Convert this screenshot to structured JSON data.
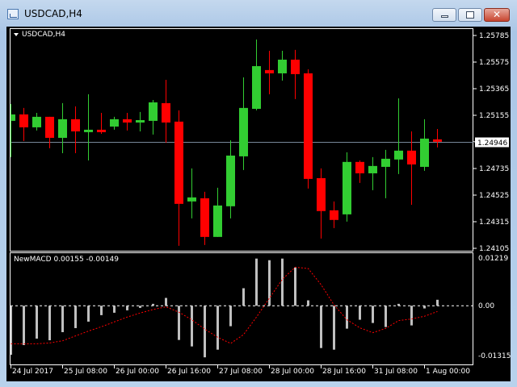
{
  "window": {
    "title": "USDCAD,H4",
    "close_glyph": "✕"
  },
  "main": {
    "symbol_label": "USDCAD,H4",
    "price_ticks": [
      "1.25785",
      "1.25575",
      "1.25365",
      "1.25155",
      "1.24946",
      "1.24735",
      "1.24525",
      "1.24315",
      "1.24105"
    ],
    "current_price": "1.24946",
    "colors": {
      "bull": "#32cd32",
      "bear": "#ff0000",
      "price_line": "#778899"
    }
  },
  "macd": {
    "label": "NewMACD 0.00155 -0.00149",
    "ticks": [
      "0.01219",
      "0.00",
      "-0.01315"
    ]
  },
  "time_labels": [
    "24 Jul 2017",
    "25 Jul 08:00",
    "26 Jul 00:00",
    "26 Jul 16:00",
    "27 Jul 08:00",
    "28 Jul 00:00",
    "28 Jul 16:00",
    "31 Jul 08:00",
    "1 Aug 00:00"
  ],
  "chart_data": [
    {
      "type": "candlestick",
      "title": "USDCAD,H4",
      "ylim": [
        1.24105,
        1.25785
      ],
      "ohlc": [
        [
          1.25111,
          1.25244,
          1.24825,
          1.25162
        ],
        [
          1.25162,
          1.25213,
          1.24952,
          1.2506
        ],
        [
          1.2506,
          1.25174,
          1.25035,
          1.25143
        ],
        [
          1.25143,
          1.25143,
          1.24895,
          1.24977
        ],
        [
          1.24977,
          1.25251,
          1.24856,
          1.25124
        ],
        [
          1.25124,
          1.25225,
          1.24856,
          1.25028
        ],
        [
          1.25022,
          1.25321,
          1.24799,
          1.25041
        ],
        [
          1.25041,
          1.25174,
          1.25009,
          1.25022
        ],
        [
          1.25066,
          1.25143,
          1.25041,
          1.25124
        ],
        [
          1.25124,
          1.25174,
          1.25035,
          1.25098
        ],
        [
          1.25098,
          1.25181,
          1.25028,
          1.25117
        ],
        [
          1.25111,
          1.25276,
          1.25003,
          1.25257
        ],
        [
          1.25251,
          1.25435,
          1.24939,
          1.25098
        ],
        [
          1.25105,
          1.25194,
          1.24125,
          1.24456
        ],
        [
          1.24475,
          1.24736,
          1.24341,
          1.24507
        ],
        [
          1.245,
          1.24551,
          1.24131,
          1.24195
        ],
        [
          1.24195,
          1.24583,
          1.24195,
          1.24443
        ],
        [
          1.24437,
          1.24958,
          1.24341,
          1.24837
        ],
        [
          1.24831,
          1.25454,
          1.24723,
          1.25213
        ],
        [
          1.25206,
          1.25753,
          1.25194,
          1.25543
        ],
        [
          1.25512,
          1.25664,
          1.25321,
          1.25486
        ],
        [
          1.25486,
          1.25664,
          1.25429,
          1.25594
        ],
        [
          1.25594,
          1.25671,
          1.25283,
          1.2548
        ],
        [
          1.25486,
          1.25518,
          1.24577,
          1.24653
        ],
        [
          1.24659,
          1.24736,
          1.24182,
          1.24399
        ],
        [
          1.24405,
          1.24475,
          1.24265,
          1.24329
        ],
        [
          1.24373,
          1.24863,
          1.24316,
          1.24787
        ],
        [
          1.24787,
          1.24799,
          1.24621,
          1.24697
        ],
        [
          1.24697,
          1.24825,
          1.24564,
          1.24755
        ],
        [
          1.24748,
          1.24882,
          1.245,
          1.24812
        ],
        [
          1.24806,
          1.25289,
          1.24691,
          1.24876
        ],
        [
          1.24876,
          1.25028,
          1.24449,
          1.24767
        ],
        [
          1.24748,
          1.25124,
          1.24717,
          1.24971
        ],
        [
          1.24965,
          1.25047,
          1.24901,
          1.24946
        ]
      ]
    },
    {
      "type": "bar+line",
      "title": "NewMACD",
      "ylim": [
        -0.01315,
        0.01219
      ],
      "histogram": [
        -0.01274,
        -0.01022,
        -0.00854,
        -0.00896,
        -0.00686,
        -0.00581,
        -0.00413,
        -0.00245,
        -0.00182,
        -0.00119,
        -0.00056,
        0.00049,
        0.00203,
        -0.00889,
        -0.01057,
        -0.0134,
        -0.01141,
        -0.00532,
        0.00455,
        0.01225,
        0.01183,
        0.01225,
        0.00994,
        0.0014,
        -0.01099,
        -0.01141,
        -0.00595,
        -0.00364,
        -0.00448,
        -0.00553,
        0.00049,
        -0.00511,
        -0.0007,
        0.00155
      ],
      "signal": [
        -0.00987,
        -0.0099,
        -0.00987,
        -0.00966,
        -0.0091,
        -0.00784,
        -0.00658,
        -0.00546,
        -0.0042,
        -0.00294,
        -0.00189,
        -0.00098,
        -0.00028,
        -0.00168,
        -0.00364,
        -0.00609,
        -0.00819,
        -0.0098,
        -0.00749,
        -0.00294,
        0.00196,
        0.00686,
        0.01001,
        0.00966,
        0.00546,
        0.00021,
        -0.00364,
        -0.00574,
        -0.007,
        -0.00588,
        -0.00385,
        -0.00343,
        -0.00273,
        -0.00149
      ],
      "colors": {
        "histogram": "#c0c0c0",
        "signal": "#ff0000"
      }
    }
  ]
}
